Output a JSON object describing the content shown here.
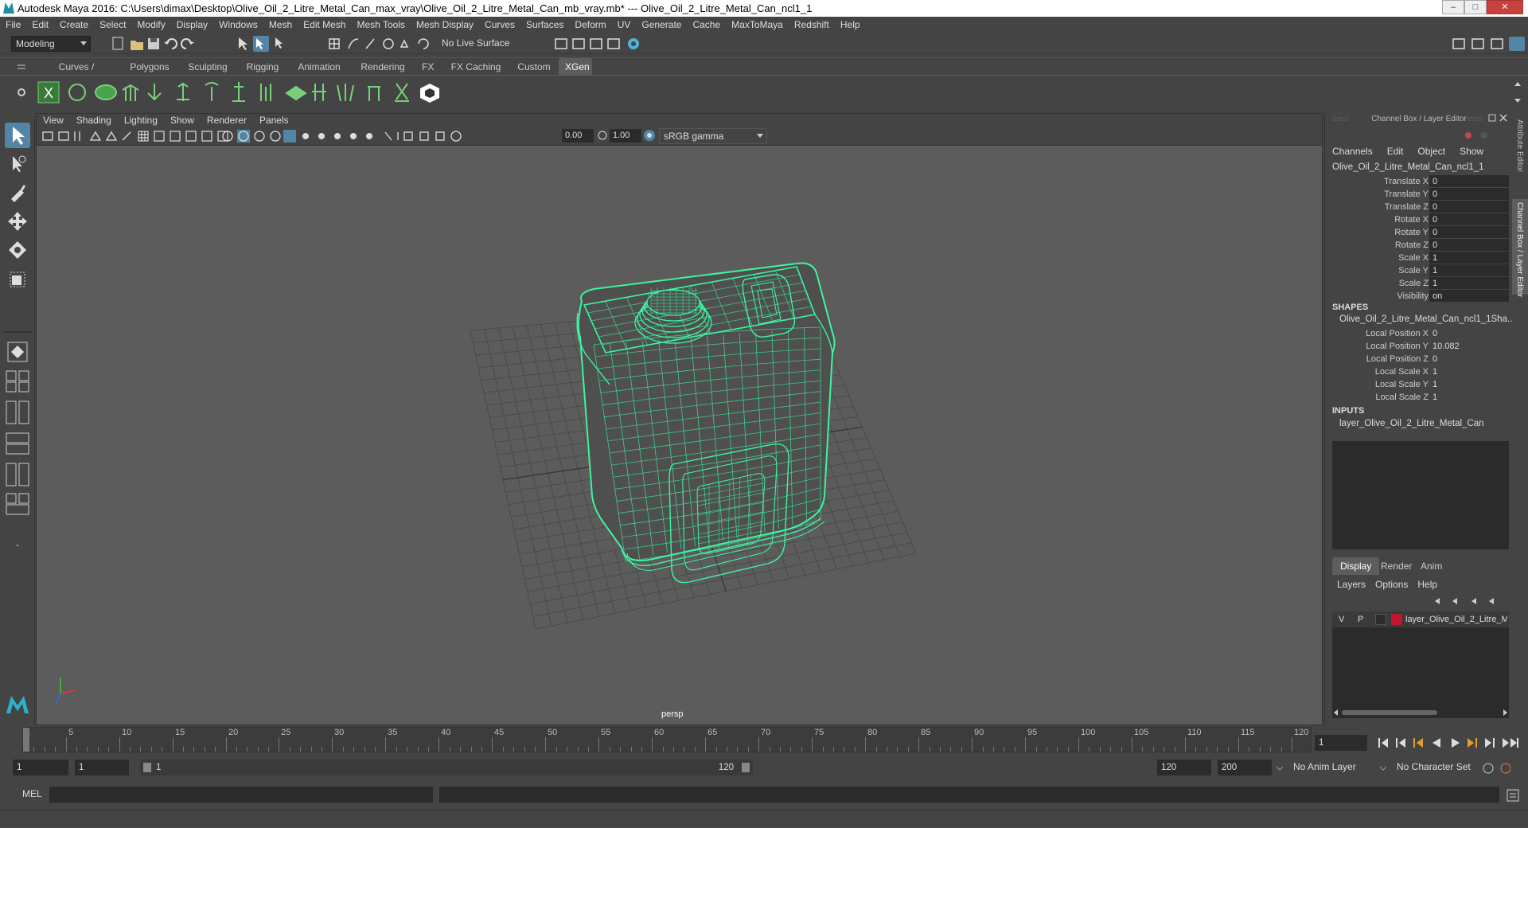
{
  "titlebar": {
    "text": "Autodesk Maya 2016: C:\\Users\\dimax\\Desktop\\Olive_Oil_2_Litre_Metal_Can_max_vray\\Olive_Oil_2_Litre_Metal_Can_mb_vray.mb*   ---   Olive_Oil_2_Litre_Metal_Can_ncl1_1"
  },
  "menubar": [
    "File",
    "Edit",
    "Create",
    "Select",
    "Modify",
    "Display",
    "Windows",
    "Mesh",
    "Edit Mesh",
    "Mesh Tools",
    "Mesh Display",
    "Curves",
    "Surfaces",
    "Deform",
    "UV",
    "Generate",
    "Cache",
    "MaxToMaya",
    "Redshift",
    "Help"
  ],
  "statusline": {
    "mode": "Modeling",
    "live_surface": "No Live Surface"
  },
  "shelf_tabs": [
    "Curves / Surfaces",
    "Polygons",
    "Sculpting",
    "Rigging",
    "Animation",
    "Rendering",
    "FX",
    "FX Caching",
    "Custom",
    "XGen"
  ],
  "active_shelf": "XGen",
  "viewport": {
    "menu": [
      "View",
      "Shading",
      "Lighting",
      "Show",
      "Renderer",
      "Panels"
    ],
    "exposure": "0.00",
    "gamma": "1.00",
    "color_space": "sRGB gamma",
    "camera": "persp",
    "wire_color": "#3df5a0"
  },
  "channelbox": {
    "title": "Channel Box / Layer Editor",
    "menu": [
      "Channels",
      "Edit",
      "Object",
      "Show"
    ],
    "object": "Olive_Oil_2_Litre_Metal_Can_ncl1_1",
    "attrs": [
      {
        "label": "Translate X",
        "value": "0"
      },
      {
        "label": "Translate Y",
        "value": "0"
      },
      {
        "label": "Translate Z",
        "value": "0"
      },
      {
        "label": "Rotate X",
        "value": "0"
      },
      {
        "label": "Rotate Y",
        "value": "0"
      },
      {
        "label": "Rotate Z",
        "value": "0"
      },
      {
        "label": "Scale X",
        "value": "1"
      },
      {
        "label": "Scale Y",
        "value": "1"
      },
      {
        "label": "Scale Z",
        "value": "1"
      },
      {
        "label": "Visibility",
        "value": "on"
      }
    ],
    "shapes_header": "SHAPES",
    "shape_name": "Olive_Oil_2_Litre_Metal_Can_ncl1_1Sha...",
    "shape_attrs": [
      {
        "label": "Local Position X",
        "value": "0"
      },
      {
        "label": "Local Position Y",
        "value": "10.082"
      },
      {
        "label": "Local Position Z",
        "value": "0"
      },
      {
        "label": "Local Scale X",
        "value": "1"
      },
      {
        "label": "Local Scale Y",
        "value": "1"
      },
      {
        "label": "Local Scale Z",
        "value": "1"
      }
    ],
    "inputs_header": "INPUTS",
    "input_name": "layer_Olive_Oil_2_Litre_Metal_Can"
  },
  "layer_editor": {
    "tabs": [
      "Display",
      "Render",
      "Anim"
    ],
    "active_tab": "Display",
    "menu": [
      "Layers",
      "Options",
      "Help"
    ],
    "layer": {
      "v": "V",
      "p": "P",
      "name": "layer_Olive_Oil_2_Litre_M",
      "color": "#c0152f"
    }
  },
  "side_tabs": [
    "Attribute Editor",
    "Channel Box / Layer Editor"
  ],
  "timeline": {
    "ticks": [
      "1",
      "5",
      "10",
      "15",
      "20",
      "25",
      "30",
      "35",
      "40",
      "45",
      "50",
      "55",
      "60",
      "65",
      "70",
      "75",
      "80",
      "85",
      "90",
      "95",
      "100",
      "105",
      "110",
      "115",
      "120"
    ],
    "current_frame": "1"
  },
  "range": {
    "start": "1",
    "anim_start": "1",
    "slider_start": "1",
    "slider_end": "120",
    "end": "120",
    "anim_end": "200",
    "anim_layer": "No Anim Layer",
    "char_set": "No Character Set"
  },
  "cmdline": {
    "lang": "MEL"
  }
}
